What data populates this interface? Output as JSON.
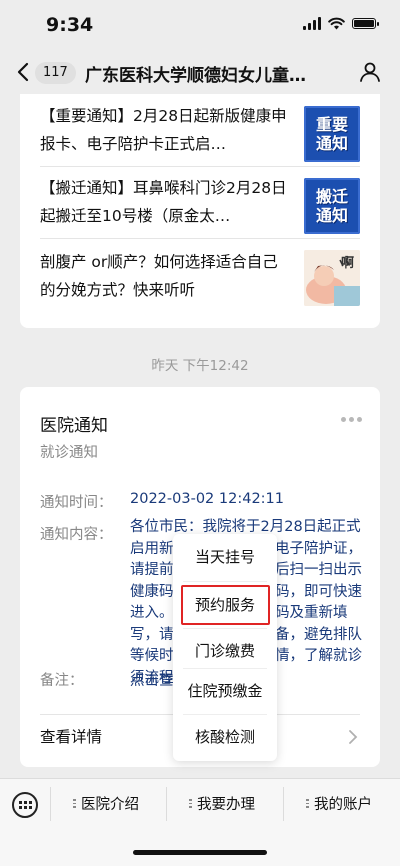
{
  "status_bar": {
    "time": "9:34"
  },
  "nav": {
    "unread_count": "117",
    "title": "广东医科大学顺德妇女儿童…"
  },
  "news": [
    {
      "text": "【重要通知】2月28日起新版健康申报卡、电子陪护卡正式启…",
      "thumb_line1": "重要",
      "thumb_line2": "通知"
    },
    {
      "text": "【搬迁通知】耳鼻喉科门诊2月28日起搬迁至10号楼（原金太…",
      "thumb_line1": "搬迁",
      "thumb_line2": "通知"
    },
    {
      "text": "剖腹产 or顺产？如何选择适合自己的分娩方式？快来听听",
      "thumb_caption": "啊"
    }
  ],
  "timestamp": "昨天 下午12:42",
  "notice": {
    "title": "医院通知",
    "subtitle": "就诊通知",
    "time_label": "通知时间：",
    "time_value": "2022-03-02 12:42:11",
    "content_label": "通知内容：",
    "content_value": "各位市民：我院将于2月28日起正式启用新版健康申报卡和电子陪护证，请提前扫码填写，来院后扫一扫出示健康码、粤康码和葵花码，即可快速进入。首次需要在扫三码及重新填写，请大家提前做好准备，避免排队等候时间。点击查看详情，了解就诊须流程。",
    "note_label": "备注：",
    "note_value": "点击查看",
    "details_label": "查看详情"
  },
  "popup_menu": {
    "items": [
      "当天挂号",
      "预约服务",
      "门诊缴费",
      "住院预缴金",
      "核酸检测"
    ],
    "highlighted": "预约服务"
  },
  "bottom_menu": {
    "tabs": [
      "医院介绍",
      "我要办理",
      "我的账户"
    ]
  }
}
